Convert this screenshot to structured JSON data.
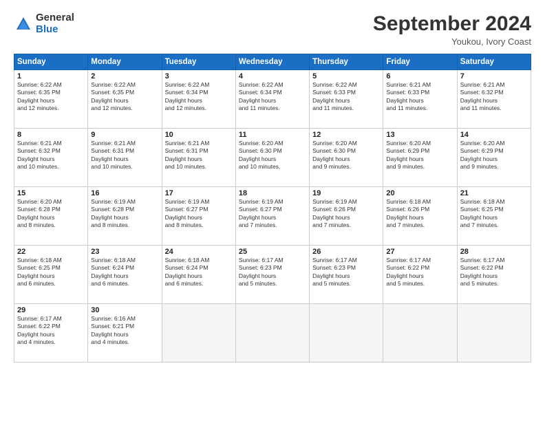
{
  "logo": {
    "general": "General",
    "blue": "Blue"
  },
  "title": "September 2024",
  "location": "Youkou, Ivory Coast",
  "days_of_week": [
    "Sunday",
    "Monday",
    "Tuesday",
    "Wednesday",
    "Thursday",
    "Friday",
    "Saturday"
  ],
  "weeks": [
    [
      {
        "day": 1,
        "rise": "6:22 AM",
        "set": "6:35 PM",
        "hours": "12 hours and 12 minutes."
      },
      {
        "day": 2,
        "rise": "6:22 AM",
        "set": "6:35 PM",
        "hours": "12 hours and 12 minutes."
      },
      {
        "day": 3,
        "rise": "6:22 AM",
        "set": "6:34 PM",
        "hours": "12 hours and 12 minutes."
      },
      {
        "day": 4,
        "rise": "6:22 AM",
        "set": "6:34 PM",
        "hours": "12 hours and 11 minutes."
      },
      {
        "day": 5,
        "rise": "6:22 AM",
        "set": "6:33 PM",
        "hours": "12 hours and 11 minutes."
      },
      {
        "day": 6,
        "rise": "6:21 AM",
        "set": "6:33 PM",
        "hours": "12 hours and 11 minutes."
      },
      {
        "day": 7,
        "rise": "6:21 AM",
        "set": "6:32 PM",
        "hours": "12 hours and 11 minutes."
      }
    ],
    [
      {
        "day": 8,
        "rise": "6:21 AM",
        "set": "6:32 PM",
        "hours": "12 hours and 10 minutes."
      },
      {
        "day": 9,
        "rise": "6:21 AM",
        "set": "6:31 PM",
        "hours": "12 hours and 10 minutes."
      },
      {
        "day": 10,
        "rise": "6:21 AM",
        "set": "6:31 PM",
        "hours": "12 hours and 10 minutes."
      },
      {
        "day": 11,
        "rise": "6:20 AM",
        "set": "6:30 PM",
        "hours": "12 hours and 10 minutes."
      },
      {
        "day": 12,
        "rise": "6:20 AM",
        "set": "6:30 PM",
        "hours": "12 hours and 9 minutes."
      },
      {
        "day": 13,
        "rise": "6:20 AM",
        "set": "6:29 PM",
        "hours": "12 hours and 9 minutes."
      },
      {
        "day": 14,
        "rise": "6:20 AM",
        "set": "6:29 PM",
        "hours": "12 hours and 9 minutes."
      }
    ],
    [
      {
        "day": 15,
        "rise": "6:20 AM",
        "set": "6:28 PM",
        "hours": "12 hours and 8 minutes."
      },
      {
        "day": 16,
        "rise": "6:19 AM",
        "set": "6:28 PM",
        "hours": "12 hours and 8 minutes."
      },
      {
        "day": 17,
        "rise": "6:19 AM",
        "set": "6:27 PM",
        "hours": "12 hours and 8 minutes."
      },
      {
        "day": 18,
        "rise": "6:19 AM",
        "set": "6:27 PM",
        "hours": "12 hours and 7 minutes."
      },
      {
        "day": 19,
        "rise": "6:19 AM",
        "set": "6:26 PM",
        "hours": "12 hours and 7 minutes."
      },
      {
        "day": 20,
        "rise": "6:18 AM",
        "set": "6:26 PM",
        "hours": "12 hours and 7 minutes."
      },
      {
        "day": 21,
        "rise": "6:18 AM",
        "set": "6:25 PM",
        "hours": "12 hours and 7 minutes."
      }
    ],
    [
      {
        "day": 22,
        "rise": "6:18 AM",
        "set": "6:25 PM",
        "hours": "12 hours and 6 minutes."
      },
      {
        "day": 23,
        "rise": "6:18 AM",
        "set": "6:24 PM",
        "hours": "12 hours and 6 minutes."
      },
      {
        "day": 24,
        "rise": "6:18 AM",
        "set": "6:24 PM",
        "hours": "12 hours and 6 minutes."
      },
      {
        "day": 25,
        "rise": "6:17 AM",
        "set": "6:23 PM",
        "hours": "12 hours and 5 minutes."
      },
      {
        "day": 26,
        "rise": "6:17 AM",
        "set": "6:23 PM",
        "hours": "12 hours and 5 minutes."
      },
      {
        "day": 27,
        "rise": "6:17 AM",
        "set": "6:22 PM",
        "hours": "12 hours and 5 minutes."
      },
      {
        "day": 28,
        "rise": "6:17 AM",
        "set": "6:22 PM",
        "hours": "12 hours and 5 minutes."
      }
    ],
    [
      {
        "day": 29,
        "rise": "6:17 AM",
        "set": "6:22 PM",
        "hours": "12 hours and 4 minutes."
      },
      {
        "day": 30,
        "rise": "6:16 AM",
        "set": "6:21 PM",
        "hours": "12 hours and 4 minutes."
      },
      null,
      null,
      null,
      null,
      null
    ]
  ]
}
